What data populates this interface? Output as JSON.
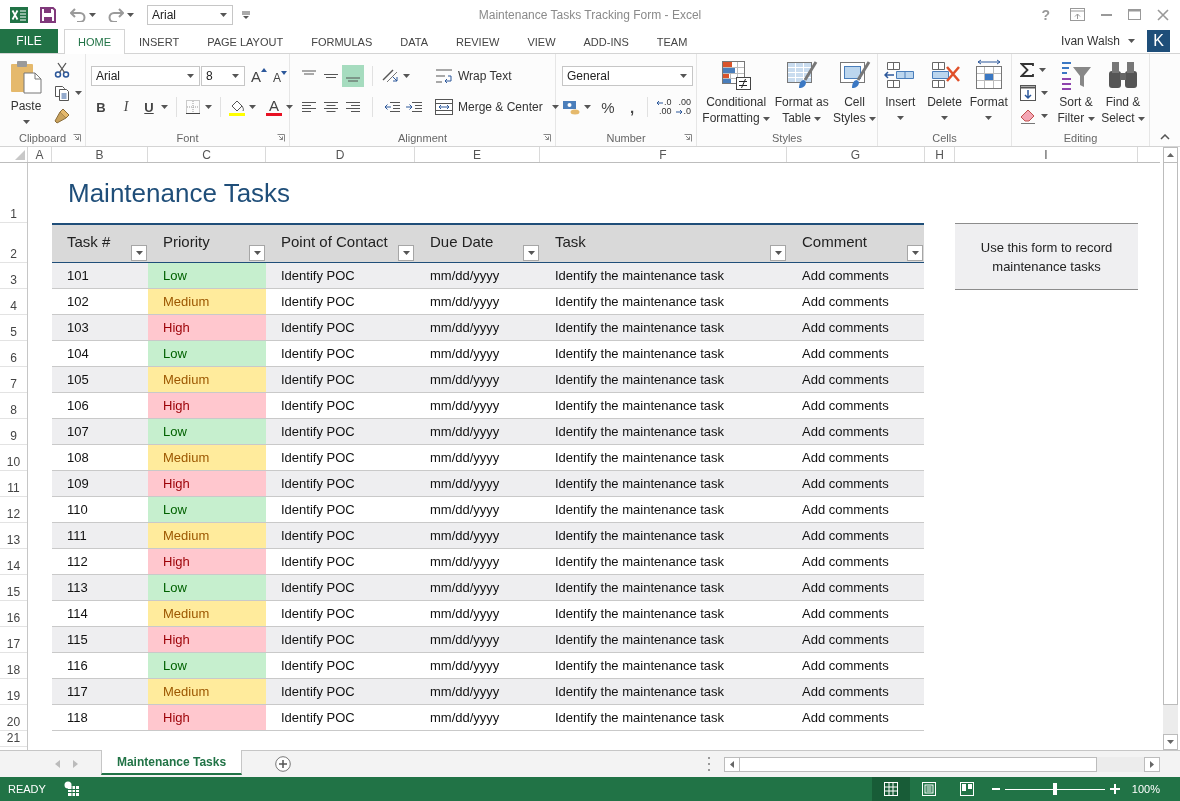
{
  "window": {
    "title": "Maintenance Tasks Tracking Form - Excel",
    "help": "?"
  },
  "quick_access": {
    "font": "Arial"
  },
  "ribbon_tabs": [
    {
      "label": "FILE",
      "kind": "backstage",
      "selected": false
    },
    {
      "label": "HOME",
      "kind": "tab",
      "selected": true
    },
    {
      "label": "INSERT",
      "kind": "tab",
      "selected": false
    },
    {
      "label": "PAGE LAYOUT",
      "kind": "tab",
      "selected": false
    },
    {
      "label": "FORMULAS",
      "kind": "tab",
      "selected": false
    },
    {
      "label": "DATA",
      "kind": "tab",
      "selected": false
    },
    {
      "label": "REVIEW",
      "kind": "tab",
      "selected": false
    },
    {
      "label": "VIEW",
      "kind": "tab",
      "selected": false
    },
    {
      "label": "ADD-INS",
      "kind": "tab",
      "selected": false
    },
    {
      "label": "TEAM",
      "kind": "tab",
      "selected": false
    }
  ],
  "account": {
    "name": "Ivan Walsh",
    "initial": "K"
  },
  "ribbon": {
    "clipboard": {
      "label": "Clipboard",
      "paste": "Paste"
    },
    "font": {
      "label": "Font",
      "name": "Arial",
      "size": "8",
      "grow": "A",
      "shrink": "A",
      "bold": "B",
      "italic": "I",
      "underline": "U",
      "color_letter": "A"
    },
    "alignment": {
      "label": "Alignment",
      "vertical": [
        {
          "kind": "top",
          "selected": false
        },
        {
          "kind": "middle",
          "selected": false
        },
        {
          "kind": "bottom",
          "selected": true
        }
      ],
      "horizontal": [
        {
          "kind": "left",
          "selected": false
        },
        {
          "kind": "center",
          "selected": false
        },
        {
          "kind": "right",
          "selected": false
        }
      ],
      "wrap_text": "Wrap Text",
      "merge_center": "Merge & Center"
    },
    "number": {
      "label": "Number",
      "format": "General",
      "percent": "%",
      "comma": ",",
      "decimals": [
        {
          "kind": "increase",
          "top": ".0",
          "bottom": ".00"
        },
        {
          "kind": "decrease",
          "top": ".00",
          "bottom": ".0"
        }
      ]
    },
    "styles": {
      "label": "Styles",
      "buttons": [
        {
          "kind": "conditional",
          "label": "Conditional Formatting"
        },
        {
          "kind": "table",
          "label": "Format as Table"
        },
        {
          "kind": "cell",
          "label": "Cell Styles"
        }
      ]
    },
    "cells": {
      "label": "Cells",
      "buttons": [
        {
          "kind": "insert",
          "label": "Insert"
        },
        {
          "kind": "delete",
          "label": "Delete"
        },
        {
          "kind": "format",
          "label": "Format"
        }
      ]
    },
    "editing": {
      "label": "Editing",
      "buttons": [
        {
          "kind": "sort",
          "label": "Sort & Filter"
        },
        {
          "kind": "find",
          "label": "Find & Select"
        }
      ]
    }
  },
  "sheet": {
    "columns": [
      "A",
      "B",
      "C",
      "D",
      "E",
      "F",
      "G",
      "H",
      "I"
    ],
    "rows": [
      "1",
      "2",
      "3",
      "4",
      "5",
      "6",
      "7",
      "8",
      "9",
      "10",
      "11",
      "12",
      "13",
      "14",
      "15",
      "16",
      "17",
      "18",
      "19",
      "20",
      "21"
    ],
    "title": "Maintenance Tasks",
    "table": {
      "columns": [
        "Task #",
        "Priority",
        "Point of Contact",
        "Due Date",
        "Task",
        "Comment"
      ],
      "rows": [
        {
          "task_no": "101",
          "priority": {
            "label": "Low",
            "kind": "low",
            "color": "#c6efce"
          },
          "contact": "Identify POC",
          "due_date": "mm/dd/yyyy",
          "task": "Identify the maintenance task",
          "comment": "Add comments"
        },
        {
          "task_no": "102",
          "priority": {
            "label": "Medium",
            "kind": "medium",
            "color": "#ffeb9c"
          },
          "contact": "Identify POC",
          "due_date": "mm/dd/yyyy",
          "task": "Identify the maintenance task",
          "comment": "Add comments"
        },
        {
          "task_no": "103",
          "priority": {
            "label": "High",
            "kind": "high",
            "color": "#ffc7ce"
          },
          "contact": "Identify POC",
          "due_date": "mm/dd/yyyy",
          "task": "Identify the maintenance task",
          "comment": "Add comments"
        },
        {
          "task_no": "104",
          "priority": {
            "label": "Low",
            "kind": "low",
            "color": "#c6efce"
          },
          "contact": "Identify POC",
          "due_date": "mm/dd/yyyy",
          "task": "Identify the maintenance task",
          "comment": "Add comments"
        },
        {
          "task_no": "105",
          "priority": {
            "label": "Medium",
            "kind": "medium",
            "color": "#ffeb9c"
          },
          "contact": "Identify POC",
          "due_date": "mm/dd/yyyy",
          "task": "Identify the maintenance task",
          "comment": "Add comments"
        },
        {
          "task_no": "106",
          "priority": {
            "label": "High",
            "kind": "high",
            "color": "#ffc7ce"
          },
          "contact": "Identify POC",
          "due_date": "mm/dd/yyyy",
          "task": "Identify the maintenance task",
          "comment": "Add comments"
        },
        {
          "task_no": "107",
          "priority": {
            "label": "Low",
            "kind": "low",
            "color": "#c6efce"
          },
          "contact": "Identify POC",
          "due_date": "mm/dd/yyyy",
          "task": "Identify the maintenance task",
          "comment": "Add comments"
        },
        {
          "task_no": "108",
          "priority": {
            "label": "Medium",
            "kind": "medium",
            "color": "#ffeb9c"
          },
          "contact": "Identify POC",
          "due_date": "mm/dd/yyyy",
          "task": "Identify the maintenance task",
          "comment": "Add comments"
        },
        {
          "task_no": "109",
          "priority": {
            "label": "High",
            "kind": "high",
            "color": "#ffc7ce"
          },
          "contact": "Identify POC",
          "due_date": "mm/dd/yyyy",
          "task": "Identify the maintenance task",
          "comment": "Add comments"
        },
        {
          "task_no": "110",
          "priority": {
            "label": "Low",
            "kind": "low",
            "color": "#c6efce"
          },
          "contact": "Identify POC",
          "due_date": "mm/dd/yyyy",
          "task": "Identify the maintenance task",
          "comment": "Add comments"
        },
        {
          "task_no": "111",
          "priority": {
            "label": "Medium",
            "kind": "medium",
            "color": "#ffeb9c"
          },
          "contact": "Identify POC",
          "due_date": "mm/dd/yyyy",
          "task": "Identify the maintenance task",
          "comment": "Add comments"
        },
        {
          "task_no": "112",
          "priority": {
            "label": "High",
            "kind": "high",
            "color": "#ffc7ce"
          },
          "contact": "Identify POC",
          "due_date": "mm/dd/yyyy",
          "task": "Identify the maintenance task",
          "comment": "Add comments"
        },
        {
          "task_no": "113",
          "priority": {
            "label": "Low",
            "kind": "low",
            "color": "#c6efce"
          },
          "contact": "Identify POC",
          "due_date": "mm/dd/yyyy",
          "task": "Identify the maintenance task",
          "comment": "Add comments"
        },
        {
          "task_no": "114",
          "priority": {
            "label": "Medium",
            "kind": "medium",
            "color": "#ffeb9c"
          },
          "contact": "Identify POC",
          "due_date": "mm/dd/yyyy",
          "task": "Identify the maintenance task",
          "comment": "Add comments"
        },
        {
          "task_no": "115",
          "priority": {
            "label": "High",
            "kind": "high",
            "color": "#ffc7ce"
          },
          "contact": "Identify POC",
          "due_date": "mm/dd/yyyy",
          "task": "Identify the maintenance task",
          "comment": "Add comments"
        },
        {
          "task_no": "116",
          "priority": {
            "label": "Low",
            "kind": "low",
            "color": "#c6efce"
          },
          "contact": "Identify POC",
          "due_date": "mm/dd/yyyy",
          "task": "Identify the maintenance task",
          "comment": "Add comments"
        },
        {
          "task_no": "117",
          "priority": {
            "label": "Medium",
            "kind": "medium",
            "color": "#ffeb9c"
          },
          "contact": "Identify POC",
          "due_date": "mm/dd/yyyy",
          "task": "Identify the maintenance task",
          "comment": "Add comments"
        },
        {
          "task_no": "118",
          "priority": {
            "label": "High",
            "kind": "high",
            "color": "#ffc7ce"
          },
          "contact": "Identify POC",
          "due_date": "mm/dd/yyyy",
          "task": "Identify the maintenance task",
          "comment": "Add comments"
        }
      ]
    },
    "note": "Use this form to record maintenance tasks"
  },
  "sheet_tabs": [
    {
      "label": "Maintenance Tasks",
      "selected": true
    }
  ],
  "status_bar": {
    "mode": "READY",
    "views": [
      {
        "kind": "normal",
        "selected": true
      },
      {
        "kind": "page_layout",
        "selected": false
      },
      {
        "kind": "page_break",
        "selected": false
      }
    ],
    "zoom": {
      "level": 0.5,
      "reading": "100%"
    }
  }
}
